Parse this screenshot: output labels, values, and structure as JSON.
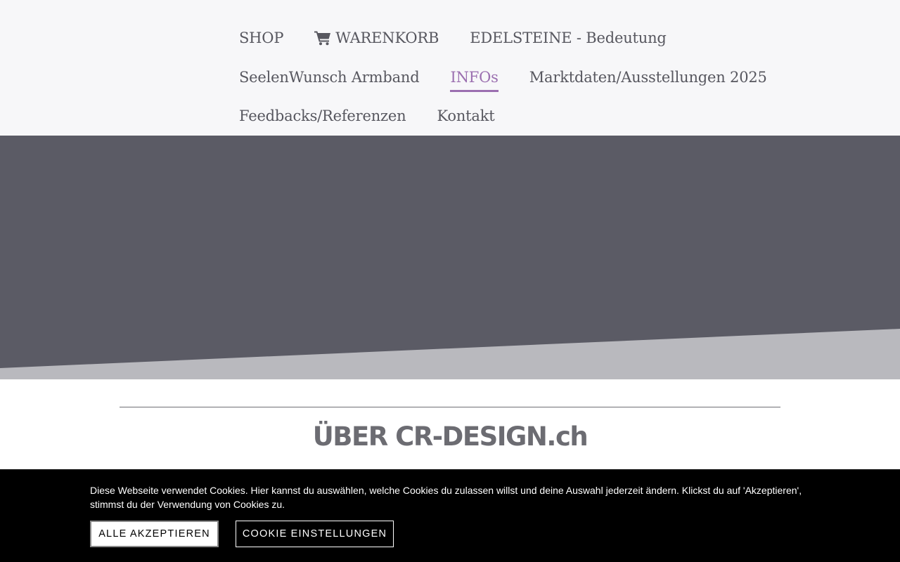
{
  "nav": {
    "row1": [
      {
        "label": "SHOP"
      },
      {
        "label": "WARENKORB",
        "icon": "shopping-cart-icon"
      },
      {
        "label": "EDELSTEINE - Bedeutung"
      }
    ],
    "row2": [
      {
        "label": "SeelenWunsch Armband"
      },
      {
        "label": "INFOs",
        "active": true
      },
      {
        "label": "Marktdaten/Ausstellungen 2025"
      }
    ],
    "row3": [
      {
        "label": "Feedbacks/Referenzen"
      },
      {
        "label": "Kontakt"
      }
    ]
  },
  "main": {
    "title": "ÜBER CR-DESIGN.ch"
  },
  "cookie": {
    "text": "Diese Webseite verwendet Cookies. Hier kannst du auswählen, welche Cookies du zulassen willst und deine Auswahl jederzeit ändern. Klickst du auf 'Akzeptieren', stimmst du der Verwendung von Cookies zu.",
    "accept_label": "ALLE AKZEPTIEREN",
    "settings_label": "COOKIE EINSTELLUNGEN"
  },
  "colors": {
    "accent": "#9b6fb0",
    "nav_text": "#57575f",
    "hero_dark": "#5b5b65",
    "hero_light": "#b9b9be",
    "cookie_bg": "#000000"
  }
}
